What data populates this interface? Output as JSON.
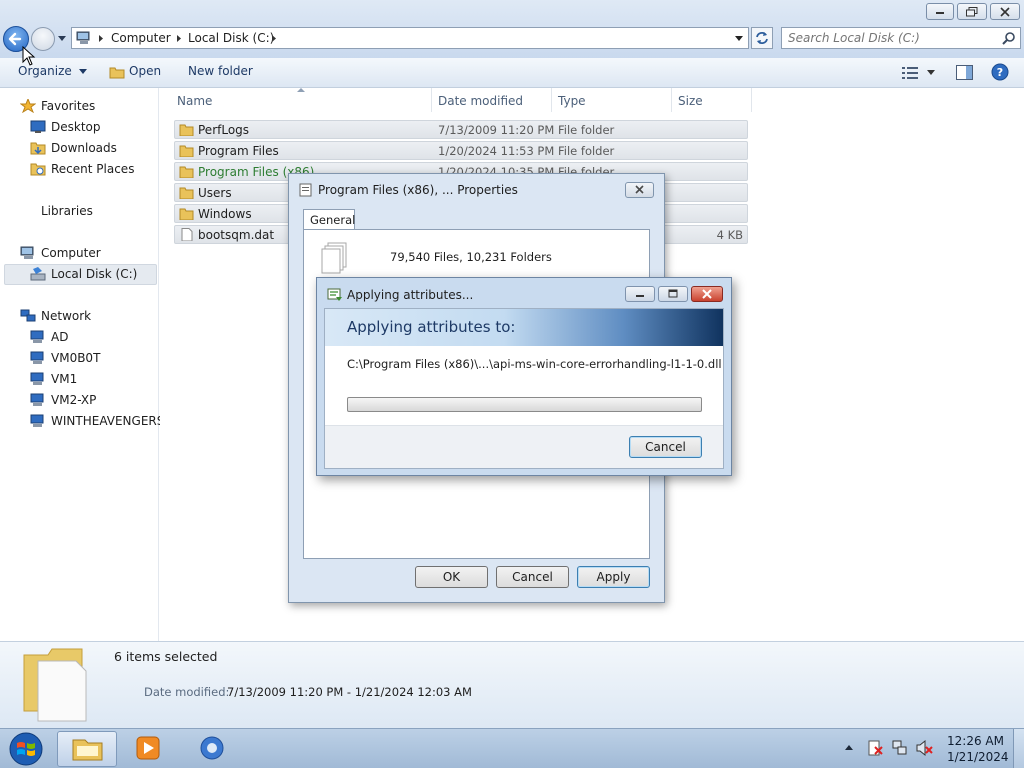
{
  "explorer": {
    "breadcrumb": [
      "Computer",
      "Local Disk (C:)"
    ],
    "search_placeholder": "Search Local Disk (C:)",
    "toolbar": {
      "organize": "Organize",
      "open": "Open",
      "new_folder": "New folder"
    },
    "nav": {
      "favorites": "Favorites",
      "favorites_items": [
        "Desktop",
        "Downloads",
        "Recent Places"
      ],
      "libraries": "Libraries",
      "computer": "Computer",
      "local_disk": "Local Disk (C:)",
      "network": "Network",
      "network_items": [
        "AD",
        "VM0B0T",
        "VM1",
        "VM2-XP",
        "WINTHEAVENGERS"
      ]
    },
    "columns": {
      "name": "Name",
      "date": "Date modified",
      "type": "Type",
      "size": "Size"
    },
    "rows": [
      {
        "name": "PerfLogs",
        "date": "7/13/2009 11:20 PM",
        "type": "File folder",
        "size": "",
        "icon": "folder-icon"
      },
      {
        "name": "Program Files",
        "date": "1/20/2024 11:53 PM",
        "type": "File folder",
        "size": "",
        "icon": "folder-icon"
      },
      {
        "name": "Program Files (x86)",
        "date": "1/20/2024 10:35 PM",
        "type": "File folder",
        "size": "",
        "icon": "folder-icon",
        "highlight": "#2e7d32"
      },
      {
        "name": "Users",
        "date": "",
        "type": "",
        "size": "",
        "icon": "folder-icon"
      },
      {
        "name": "Windows",
        "date": "",
        "type": "",
        "size": "",
        "icon": "folder-icon"
      },
      {
        "name": "bootsqm.dat",
        "date": "",
        "type": "",
        "size": "4 KB",
        "icon": "file-icon"
      }
    ],
    "details": {
      "selection": "6 items selected",
      "date_label": "Date modified:",
      "date_range": "7/13/2009 11:20 PM - 1/21/2024 12:03 AM"
    }
  },
  "properties_dialog": {
    "title": "Program Files (x86), ... Properties",
    "tab": "General",
    "summary": "79,540 Files, 10,231 Folders",
    "ok": "OK",
    "cancel": "Cancel",
    "apply": "Apply"
  },
  "apply_dialog": {
    "title": "Applying attributes...",
    "heading": "Applying attributes to:",
    "path": "C:\\Program Files (x86)\\...\\api-ms-win-core-errorhandling-l1-1-0.dll",
    "progress": 0,
    "cancel": "Cancel"
  },
  "taskbar": {
    "time": "12:26 AM",
    "date": "1/21/2024"
  },
  "colors": {
    "accent": "#2466c4",
    "selection_row": "#e4e7eb",
    "taskbar": "#a9c1dc"
  }
}
